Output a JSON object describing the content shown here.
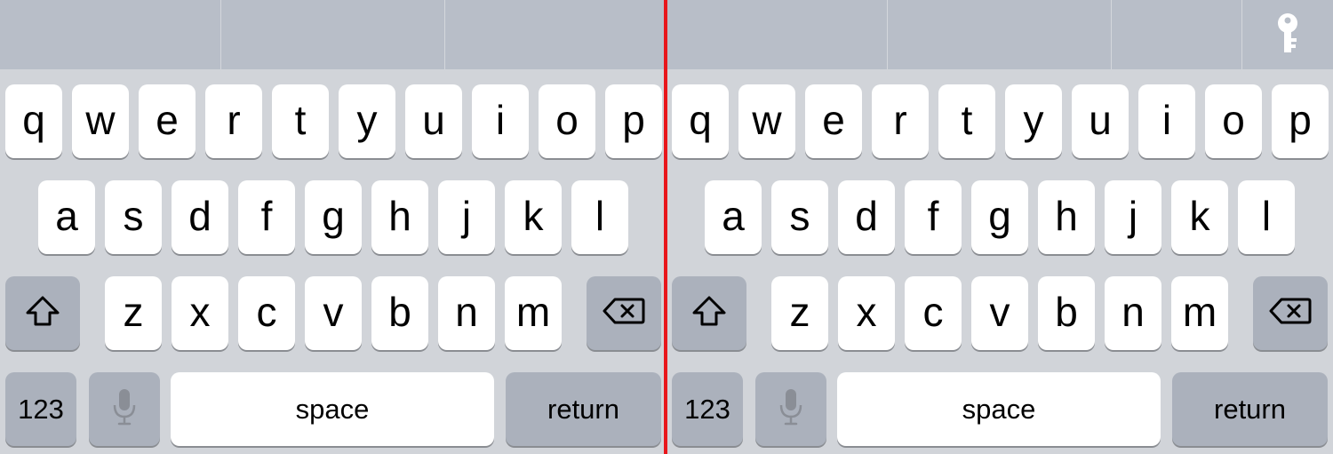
{
  "colors": {
    "keyboard_bg": "#d1d4d9",
    "suggestion_bar_bg": "#b8bec8",
    "letter_key_bg": "#ffffff",
    "function_key_bg": "#abb1bc",
    "split_line": "#e8161b"
  },
  "keyboards": [
    {
      "name": "keyboard-left",
      "suggestion_bar": {
        "show_key_icon": false,
        "key_icon": "key-icon"
      },
      "rows": [
        [
          "q",
          "w",
          "e",
          "r",
          "t",
          "y",
          "u",
          "i",
          "o",
          "p"
        ],
        [
          "a",
          "s",
          "d",
          "f",
          "g",
          "h",
          "j",
          "k",
          "l"
        ],
        [
          "z",
          "x",
          "c",
          "v",
          "b",
          "n",
          "m"
        ]
      ],
      "shift_icon": "shift-arrow-icon",
      "delete_icon": "delete-backspace-icon",
      "numbers_label": "123",
      "mic_icon": "microphone-icon",
      "space_label": "space",
      "return_label": "return"
    },
    {
      "name": "keyboard-right",
      "suggestion_bar": {
        "show_key_icon": true,
        "key_icon": "key-icon"
      },
      "rows": [
        [
          "q",
          "w",
          "e",
          "r",
          "t",
          "y",
          "u",
          "i",
          "o",
          "p"
        ],
        [
          "a",
          "s",
          "d",
          "f",
          "g",
          "h",
          "j",
          "k",
          "l"
        ],
        [
          "z",
          "x",
          "c",
          "v",
          "b",
          "n",
          "m"
        ]
      ],
      "shift_icon": "shift-arrow-icon",
      "delete_icon": "delete-backspace-icon",
      "numbers_label": "123",
      "mic_icon": "microphone-icon",
      "space_label": "space",
      "return_label": "return"
    }
  ]
}
